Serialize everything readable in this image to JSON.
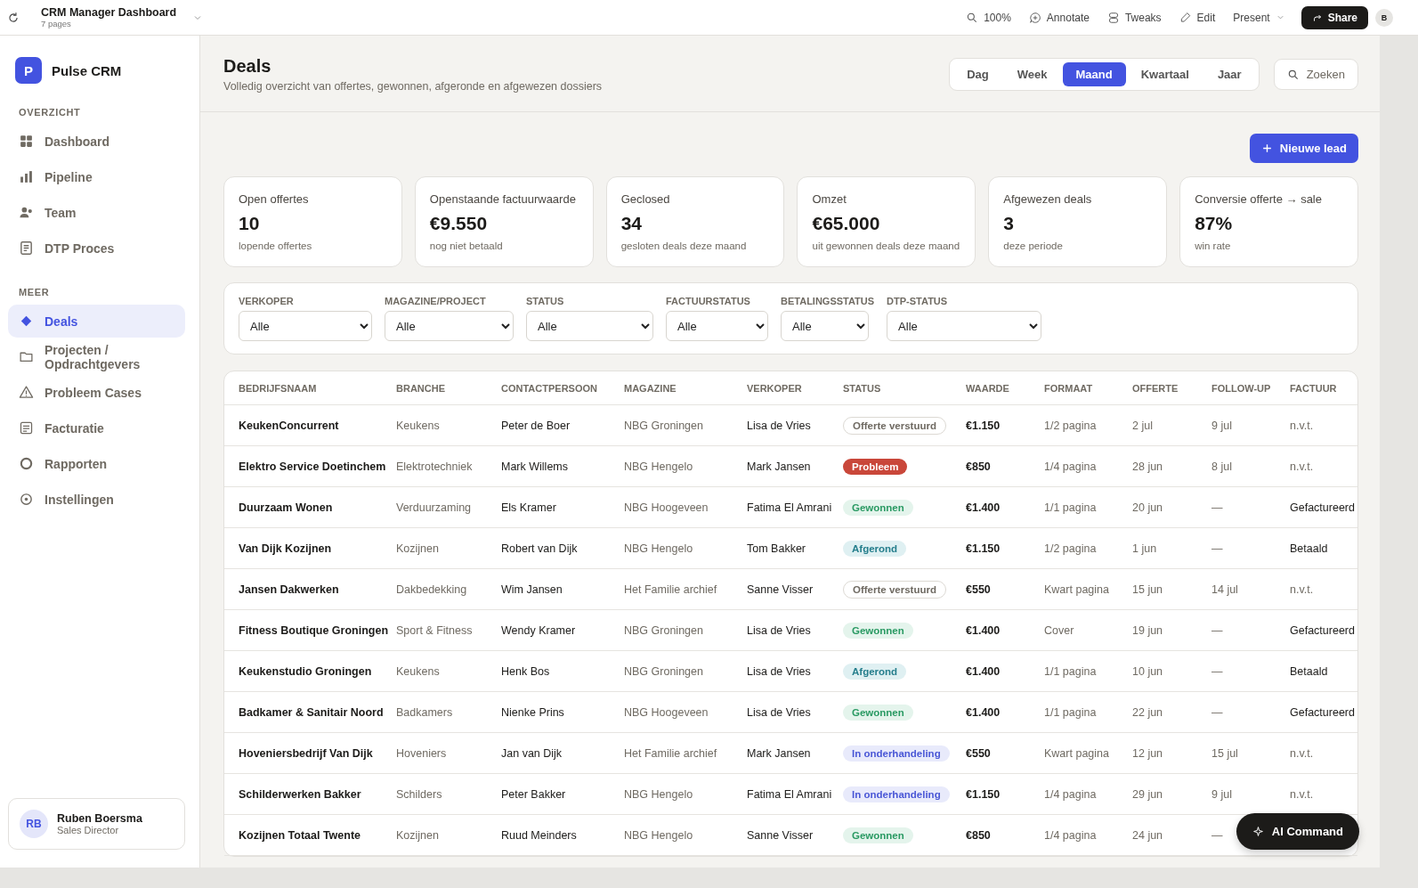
{
  "topbar": {
    "title": "CRM Manager Dashboard",
    "subtitle": "7 pages",
    "actions": [
      {
        "kind": "zoom",
        "label": "100%"
      },
      {
        "kind": "annotate",
        "label": "Annotate"
      },
      {
        "kind": "tweaks",
        "label": "Tweaks"
      },
      {
        "kind": "edit",
        "label": "Edit"
      },
      {
        "kind": "present",
        "label": "Present"
      }
    ],
    "share": "Share",
    "avatar": "B"
  },
  "sidebar": {
    "logo": "P",
    "brand": "Pulse CRM",
    "sections": [
      {
        "heading": "OVERZICHT",
        "items": [
          {
            "label": "Dashboard",
            "selected": false
          },
          {
            "label": "Pipeline",
            "selected": false
          },
          {
            "label": "Team",
            "selected": false
          },
          {
            "label": "DTP Proces",
            "selected": false
          }
        ]
      },
      {
        "heading": "MEER",
        "items": [
          {
            "label": "Deals",
            "selected": true
          },
          {
            "label": "Projecten / Opdrachtgevers",
            "selected": false
          },
          {
            "label": "Probleem Cases",
            "selected": false
          },
          {
            "label": "Facturatie",
            "selected": false
          },
          {
            "label": "Rapporten",
            "selected": false
          },
          {
            "label": "Instellingen",
            "selected": false
          }
        ]
      }
    ],
    "user": {
      "initials": "RB",
      "name": "Ruben Boersma",
      "role": "Sales Director"
    }
  },
  "header": {
    "title": "Deals",
    "subtitle": "Volledig overzicht van offertes, gewonnen, afgeronde en afgewezen dossiers",
    "periods": [
      {
        "label": "Dag",
        "selected": false
      },
      {
        "label": "Week",
        "selected": false
      },
      {
        "label": "Maand",
        "selected": true
      },
      {
        "label": "Kwartaal",
        "selected": false
      },
      {
        "label": "Jaar",
        "selected": false
      }
    ],
    "search": "Zoeken"
  },
  "new_lead": "Nieuwe lead",
  "stats": [
    {
      "label": "Open offertes",
      "value": "10",
      "note": "lopende offertes"
    },
    {
      "label": "Openstaande factuurwaarde",
      "value": "€9.550",
      "note": "nog niet betaald"
    },
    {
      "label": "Geclosed",
      "value": "34",
      "note": "gesloten deals deze maand"
    },
    {
      "label": "Omzet",
      "value": "€65.000",
      "note": "uit gewonnen deals deze maand"
    },
    {
      "label": "Afgewezen deals",
      "value": "3",
      "note": "deze periode"
    },
    {
      "label": "Conversie offerte → sale",
      "value": "87%",
      "note": "win rate"
    }
  ],
  "filters": [
    {
      "label": "VERKOPER",
      "value": "Alle"
    },
    {
      "label": "MAGAZINE/PROJECT",
      "value": "Alle"
    },
    {
      "label": "STATUS",
      "value": "Alle"
    },
    {
      "label": "FACTUURSTATUS",
      "value": "Alle"
    },
    {
      "label": "BETALINGSSTATUS",
      "value": "Alle"
    },
    {
      "label": "DTP-STATUS",
      "value": "Alle"
    }
  ],
  "table": {
    "columns": [
      "BEDRIJFSNAAM",
      "BRANCHE",
      "CONTACTPERSOON",
      "MAGAZINE",
      "VERKOPER",
      "STATUS",
      "WAARDE",
      "FORMAAT",
      "OFFERTE",
      "FOLLOW-UP",
      "FACTUUR"
    ],
    "rows": [
      {
        "company": "KeukenConcurrent",
        "branche": "Keukens",
        "contact": "Peter de Boer",
        "magazine": "NBG Groningen",
        "seller": "Lisa de Vries",
        "status": {
          "kind": "sent",
          "label": "Offerte verstuurd"
        },
        "value": "€1.150",
        "format": "1/2 pagina",
        "quote": "2 jul",
        "followup": "9 jul",
        "invoice": {
          "kind": "none",
          "label": "n.v.t."
        }
      },
      {
        "company": "Elektro Service Doetinchem",
        "branche": "Elektrotechniek",
        "contact": "Mark Willems",
        "magazine": "NBG Hengelo",
        "seller": "Mark Jansen",
        "status": {
          "kind": "problem",
          "label": "Probleem"
        },
        "value": "€850",
        "format": "1/4 pagina",
        "quote": "28 jun",
        "followup": "8 jul",
        "invoice": {
          "kind": "none",
          "label": "n.v.t."
        }
      },
      {
        "company": "Duurzaam Wonen",
        "branche": "Verduurzaming",
        "contact": "Els Kramer",
        "magazine": "NBG Hoogeveen",
        "seller": "Fatima El Amrani",
        "status": {
          "kind": "won",
          "label": "Gewonnen"
        },
        "value": "€1.400",
        "format": "1/1 pagina",
        "quote": "20 jun",
        "followup": "—",
        "invoice": {
          "kind": "done",
          "label": "Gefactureerd"
        }
      },
      {
        "company": "Van Dijk Kozijnen",
        "branche": "Kozijnen",
        "contact": "Robert van Dijk",
        "magazine": "NBG Hengelo",
        "seller": "Tom Bakker",
        "status": {
          "kind": "closed",
          "label": "Afgerond"
        },
        "value": "€1.150",
        "format": "1/2 pagina",
        "quote": "1 jun",
        "followup": "—",
        "invoice": {
          "kind": "done",
          "label": "Betaald"
        }
      },
      {
        "company": "Jansen Dakwerken",
        "branche": "Dakbedekking",
        "contact": "Wim Jansen",
        "magazine": "Het Familie archief",
        "seller": "Sanne Visser",
        "status": {
          "kind": "sent",
          "label": "Offerte verstuurd"
        },
        "value": "€550",
        "format": "Kwart pagina",
        "quote": "15 jun",
        "followup": "14 jul",
        "invoice": {
          "kind": "none",
          "label": "n.v.t."
        }
      },
      {
        "company": "Fitness Boutique Groningen",
        "branche": "Sport & Fitness",
        "contact": "Wendy Kramer",
        "magazine": "NBG Groningen",
        "seller": "Lisa de Vries",
        "status": {
          "kind": "won",
          "label": "Gewonnen"
        },
        "value": "€1.400",
        "format": "Cover",
        "quote": "19 jun",
        "followup": "—",
        "invoice": {
          "kind": "done",
          "label": "Gefactureerd"
        }
      },
      {
        "company": "Keukenstudio Groningen",
        "branche": "Keukens",
        "contact": "Henk Bos",
        "magazine": "NBG Groningen",
        "seller": "Lisa de Vries",
        "status": {
          "kind": "closed",
          "label": "Afgerond"
        },
        "value": "€1.400",
        "format": "1/1 pagina",
        "quote": "10 jun",
        "followup": "—",
        "invoice": {
          "kind": "done",
          "label": "Betaald"
        }
      },
      {
        "company": "Badkamer & Sanitair Noord",
        "branche": "Badkamers",
        "contact": "Nienke Prins",
        "magazine": "NBG Hoogeveen",
        "seller": "Lisa de Vries",
        "status": {
          "kind": "won",
          "label": "Gewonnen"
        },
        "value": "€1.400",
        "format": "1/1 pagina",
        "quote": "22 jun",
        "followup": "—",
        "invoice": {
          "kind": "done",
          "label": "Gefactureerd"
        }
      },
      {
        "company": "Hoveniersbedrijf Van Dijk",
        "branche": "Hoveniers",
        "contact": "Jan van Dijk",
        "magazine": "Het Familie archief",
        "seller": "Mark Jansen",
        "status": {
          "kind": "negotiating",
          "label": "In onderhandeling"
        },
        "value": "€550",
        "format": "Kwart pagina",
        "quote": "12 jun",
        "followup": "15 jul",
        "invoice": {
          "kind": "none",
          "label": "n.v.t."
        }
      },
      {
        "company": "Schilderwerken Bakker",
        "branche": "Schilders",
        "contact": "Peter Bakker",
        "magazine": "NBG Hengelo",
        "seller": "Fatima El Amrani",
        "status": {
          "kind": "negotiating",
          "label": "In onderhandeling"
        },
        "value": "€1.150",
        "format": "1/4 pagina",
        "quote": "29 jun",
        "followup": "9 jul",
        "invoice": {
          "kind": "none",
          "label": "n.v.t."
        }
      },
      {
        "company": "Kozijnen Totaal Twente",
        "branche": "Kozijnen",
        "contact": "Ruud Meinders",
        "magazine": "NBG Hengelo",
        "seller": "Sanne Visser",
        "status": {
          "kind": "won",
          "label": "Gewonnen"
        },
        "value": "€850",
        "format": "1/4 pagina",
        "quote": "24 jun",
        "followup": "—"
      }
    ]
  },
  "ai_command": "AI Command"
}
